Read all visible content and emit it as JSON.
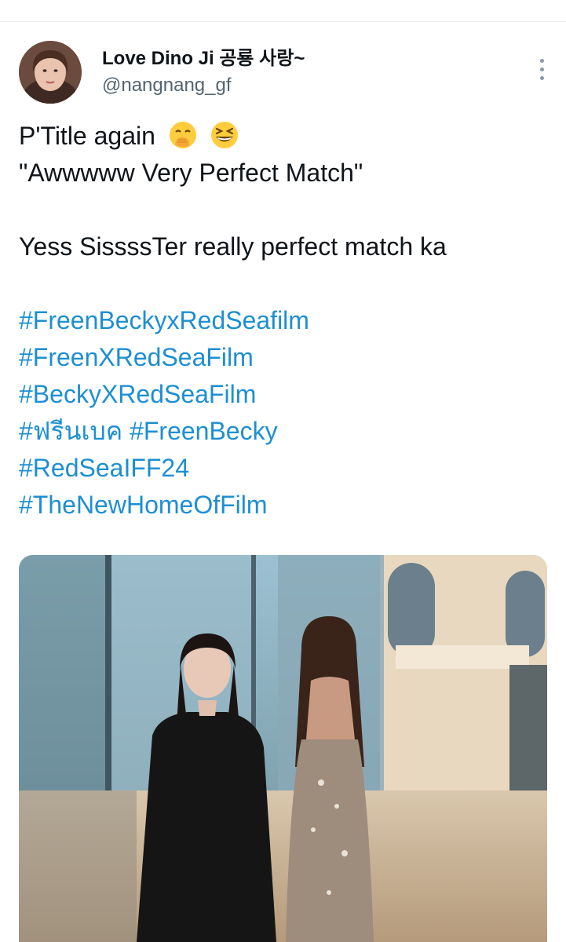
{
  "author": {
    "display_name": "Love Dino Ji 공룡 사랑~",
    "handle": "@nangnang_gf"
  },
  "tweet": {
    "line1": "P'Title again",
    "line1_emojis": [
      "hand-over-mouth-emoji",
      "grinning-squinting-face-emoji"
    ],
    "line2": "\"Awwwww Very Perfect Match\"",
    "line3": "Yess SissssTer really perfect match ka",
    "hashtags": {
      "h1": "#FreenBeckyxRedSeafilm",
      "h2": "#FreenXRedSeaFilm",
      "h3": "#BeckyXRedSeaFilm",
      "h4a": "#ฟรีนเบค",
      "h4b": "#FreenBecky",
      "h5": "#RedSeaIFF24",
      "h6": "#TheNewHomeOfFilm"
    }
  },
  "colors": {
    "hashtag": "#1d8fd1",
    "handle": "#536471",
    "divider": "#e6ecf0"
  },
  "icons": [
    "more-options-icon"
  ]
}
